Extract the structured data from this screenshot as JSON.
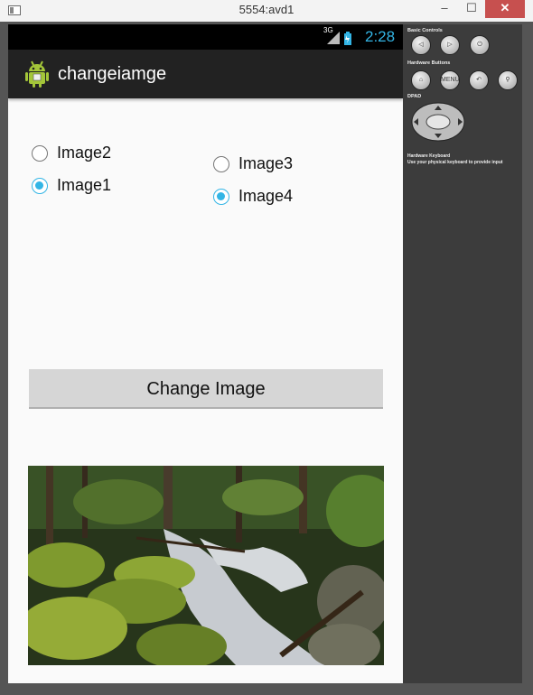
{
  "window": {
    "title": "5554:avd1"
  },
  "status_bar": {
    "network": "3G",
    "time": "2:28"
  },
  "action_bar": {
    "title": "changeiamge"
  },
  "radios": [
    {
      "label": "Image2",
      "checked": false
    },
    {
      "label": "Image1",
      "checked": true
    },
    {
      "label": "Image3",
      "checked": false
    },
    {
      "label": "Image4",
      "checked": true
    }
  ],
  "button": {
    "label": "Change Image"
  },
  "controls": {
    "basic_label": "Basic Controls",
    "hardware_label": "Hardware Buttons",
    "menu_label": "MENU",
    "dpad_label": "DPAD",
    "keyboard_label": "Hardware Keyboard",
    "keyboard_note": "Use your physical keyboard to provide input"
  },
  "colors": {
    "accent": "#33b5e5",
    "action_bar": "#222222",
    "panel": "#3c3c3c"
  }
}
